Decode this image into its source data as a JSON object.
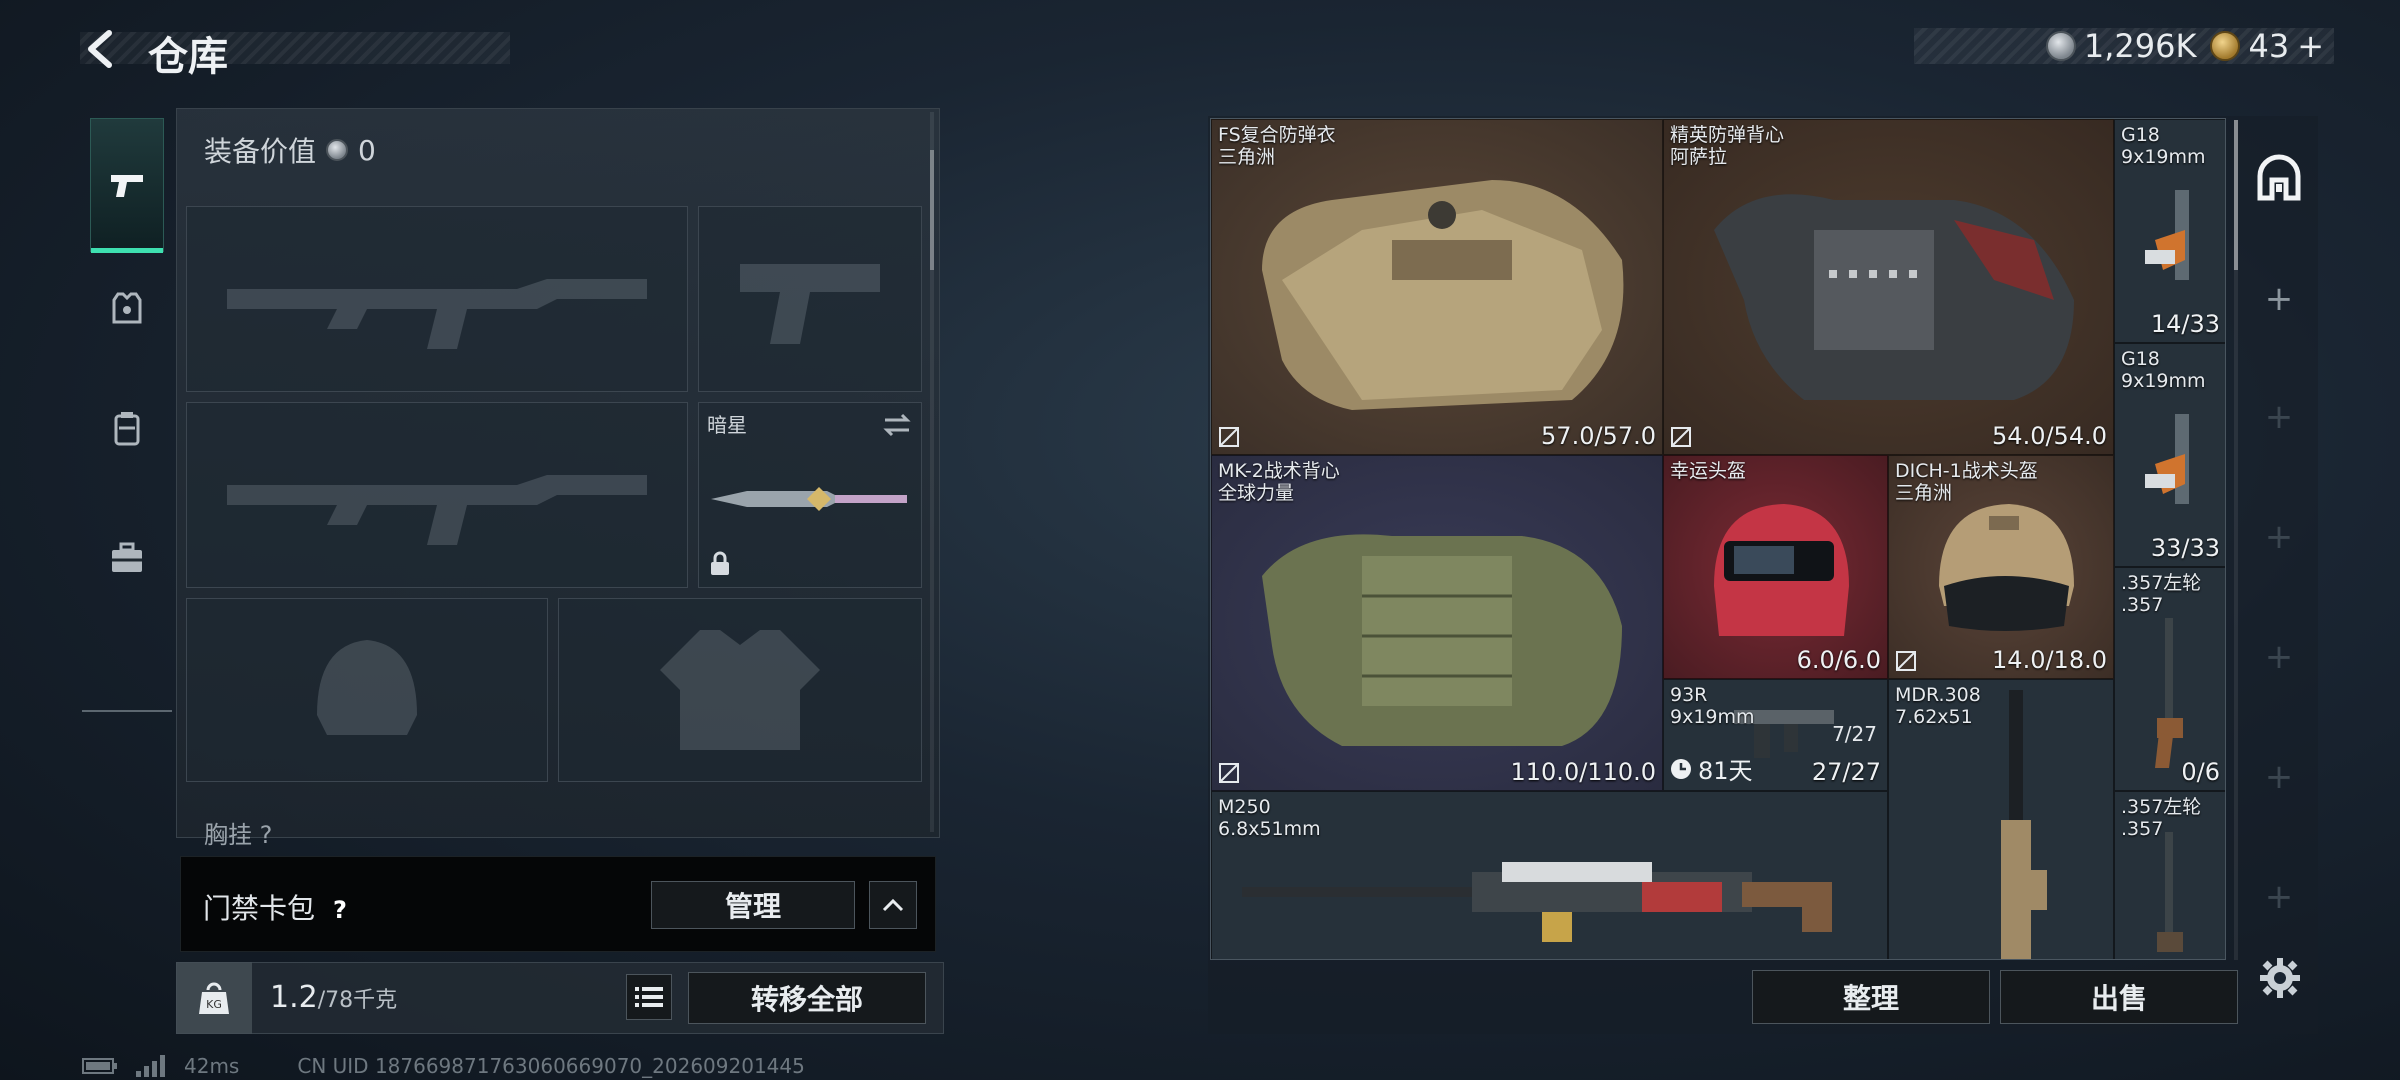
{
  "header": {
    "title": "仓库",
    "back_icon": "back-arrow-icon",
    "silver_amount": "1,296K",
    "gold_amount": "43",
    "gold_add": "+"
  },
  "equipment": {
    "value_label": "装备价值",
    "value": "0",
    "melee_slot_name": "暗星",
    "chest_label": "胸挂",
    "chest_count": "?"
  },
  "access_card": {
    "label": "门禁卡包",
    "help": "?",
    "manage_label": "管理"
  },
  "footer": {
    "weight_value": "1.2",
    "weight_capacity": "/78千克",
    "transfer_all_label": "转移全部",
    "organize_label": "整理",
    "sell_label": "出售"
  },
  "status": {
    "ping": "42ms",
    "uid": "CN UID 1876698717630606690​70_202609201445"
  },
  "stash_items": [
    {
      "name": "FS复合防弹衣\n三角洲",
      "durability": "57.0/57.0"
    },
    {
      "name": "精英防弹背心\n阿萨拉",
      "durability": "54.0/54.0"
    },
    {
      "name": "G18\n9x19mm",
      "durability": "14/33"
    },
    {
      "name": "G18\n9x19mm",
      "durability": "33/33"
    },
    {
      "name": "MK-2战术背心\n全球力量",
      "durability": "110.0/110.0"
    },
    {
      "name": "幸运头盔",
      "durability": "6.0/6.0"
    },
    {
      "name": "DICH-1战术头盔\n三角洲",
      "durability": "14.0/18.0"
    },
    {
      "name": ".357左轮\n.357",
      "durability": "0/6"
    },
    {
      "name": "93R\n9x19mm",
      "durability": "27/27",
      "ammo_extra": "7/27",
      "timer": "81天"
    },
    {
      "name": "MDR.308\n7.62x51",
      "durability": ""
    },
    {
      "name": "M250\n6.8x51mm",
      "durability": ""
    },
    {
      "name": ".357左轮\n.357",
      "durability": ""
    }
  ],
  "side_tabs": [
    "helmet-tab-icon",
    "add-icon",
    "add-icon",
    "add-icon",
    "add-icon",
    "add-icon",
    "add-icon"
  ],
  "colors": {
    "accent": "#3ee0b0",
    "armor_bg": "#4a3a30",
    "vest_bg": "#2e3246",
    "helmet_bg": "#5a2a30",
    "helmet2_bg": "#433530"
  }
}
